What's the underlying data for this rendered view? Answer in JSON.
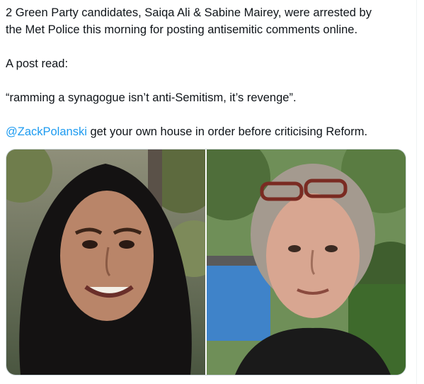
{
  "tweet": {
    "line1": "2 Green Party candidates, Saiqa Ali & Sabine Mairey, were arrested by",
    "line2": "the Met Police this morning for posting antisemitic comments online.",
    "line3": "A post read:",
    "line4": "“ramming a synagogue isn’t anti-Semitism, it’s revenge”.",
    "mention": "@ZackPolanski",
    "line5_rest": " get your own house in order before criticising Reform."
  },
  "media": {
    "count": 2,
    "photos": [
      {
        "subject": "woman-in-black-hijab-portrait"
      },
      {
        "subject": "woman-with-sunglasses-on-head-portrait"
      }
    ]
  },
  "colors": {
    "text": "#0f1419",
    "mention": "#1d9bf0",
    "border": "#cfd9de"
  }
}
